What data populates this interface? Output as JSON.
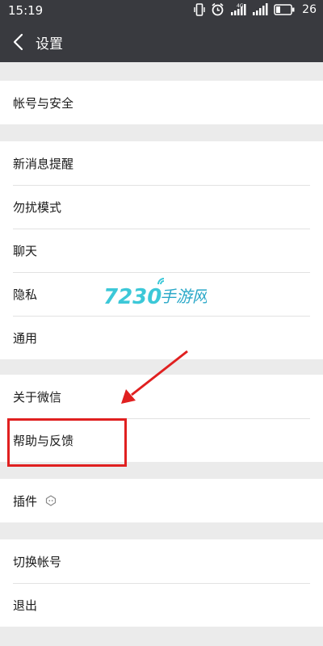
{
  "status_bar": {
    "time": "15:19",
    "battery_level": "26",
    "icons": [
      "vibrate-icon",
      "alarm-icon",
      "signal-4g-icon",
      "signal-icon",
      "battery-icon"
    ]
  },
  "toolbar": {
    "title": "设置",
    "back_icon": "chevron-left-icon"
  },
  "groups": [
    {
      "items": [
        {
          "label": "帐号与安全"
        }
      ]
    },
    {
      "items": [
        {
          "label": "新消息提醒"
        },
        {
          "label": "勿扰模式"
        },
        {
          "label": "聊天"
        },
        {
          "label": "隐私"
        },
        {
          "label": "通用"
        }
      ]
    },
    {
      "items": [
        {
          "label": "关于微信"
        },
        {
          "label": "帮助与反馈",
          "highlighted": true
        }
      ]
    },
    {
      "items": [
        {
          "label": "插件",
          "icon": "plugin-icon"
        }
      ]
    },
    {
      "items": [
        {
          "label": "切换帐号"
        },
        {
          "label": "退出"
        }
      ]
    }
  ],
  "watermark": {
    "number": "7230",
    "text": "手游网",
    "color_number": "#3cc8d8",
    "color_text": "#2aa8c8"
  },
  "annotation": {
    "color": "#e02020"
  }
}
